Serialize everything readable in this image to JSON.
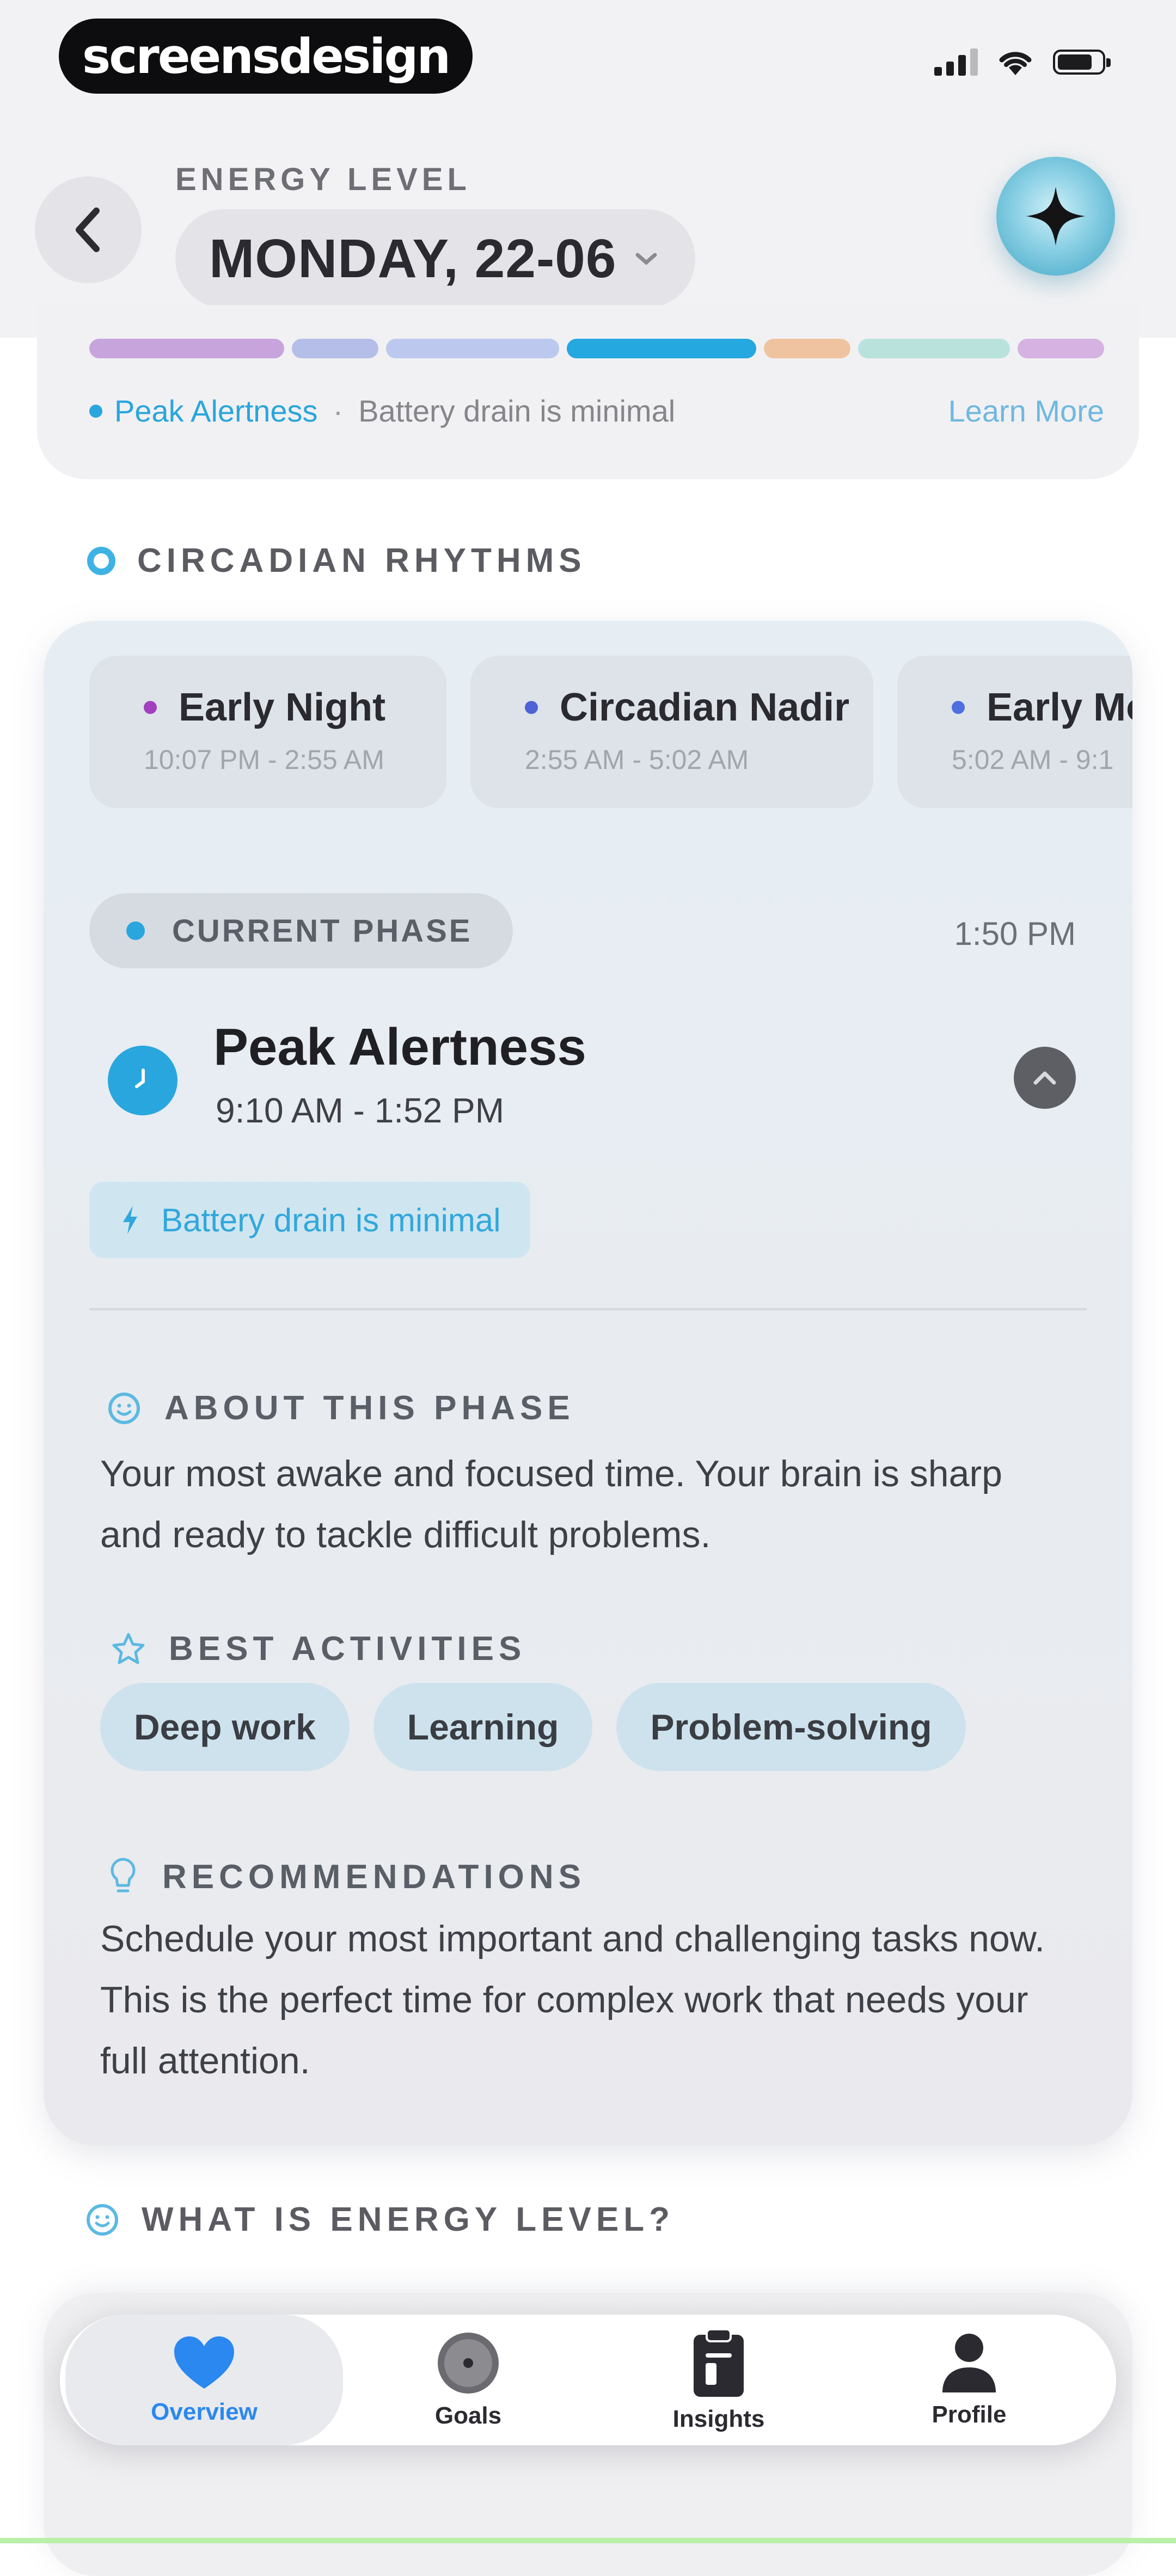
{
  "status_bar": {
    "brand": "screensdesign"
  },
  "header": {
    "eyebrow": "ENERGY LEVEL",
    "date": "MONDAY, 22-06"
  },
  "energy_timeline": {
    "segments": [
      {
        "color": "#c8a4dd"
      },
      {
        "color": "#b4bee8"
      },
      {
        "color": "#bcc8ee"
      },
      {
        "color": "#25a7e0"
      },
      {
        "color": "#f0c3a0"
      },
      {
        "color": "#b9e2dc"
      },
      {
        "color": "#d6b2e2"
      }
    ],
    "current_phase": "Peak Alertness",
    "separator": "·",
    "note": "Battery drain is minimal",
    "link": "Learn More"
  },
  "circadian": {
    "heading": "CIRCADIAN RHYTHMS",
    "phases": [
      {
        "name": "Early Night",
        "time": "10:07 PM - 2:55 AM",
        "dot_color": "#a23fbf"
      },
      {
        "name": "Circadian Nadir",
        "time": "2:55 AM - 5:02 AM",
        "dot_color": "#4e61d6"
      },
      {
        "name": "Early Mo",
        "time": "5:02 AM - 9:1",
        "dot_color": "#4d6fe0"
      }
    ],
    "current_label": "CURRENT PHASE",
    "current_time": "1:50 PM",
    "phase_name": "Peak Alertness",
    "phase_range": "9:10 AM - 1:52 PM",
    "drain_badge": "Battery drain is minimal",
    "about_heading": "ABOUT THIS PHASE",
    "about_text": "Your most awake and focused time. Your brain is sharp and ready to tackle difficult problems.",
    "activities_heading": "BEST ACTIVITIES",
    "activities": [
      "Deep work",
      "Learning",
      "Problem-solving"
    ],
    "recommendations_heading": "RECOMMENDATIONS",
    "recommendations_text": "Schedule your most important and challenging tasks now. This is the perfect time for complex work that needs your full attention."
  },
  "what_is": {
    "heading": "WHAT IS ENERGY LEVEL?"
  },
  "tabs": [
    {
      "label": "Overview",
      "active": true
    },
    {
      "label": "Goals",
      "active": false
    },
    {
      "label": "Insights",
      "active": false
    },
    {
      "label": "Profile",
      "active": false
    }
  ],
  "colors": {
    "accent": "#2aa6de",
    "tab_active": "#2a88f0"
  }
}
